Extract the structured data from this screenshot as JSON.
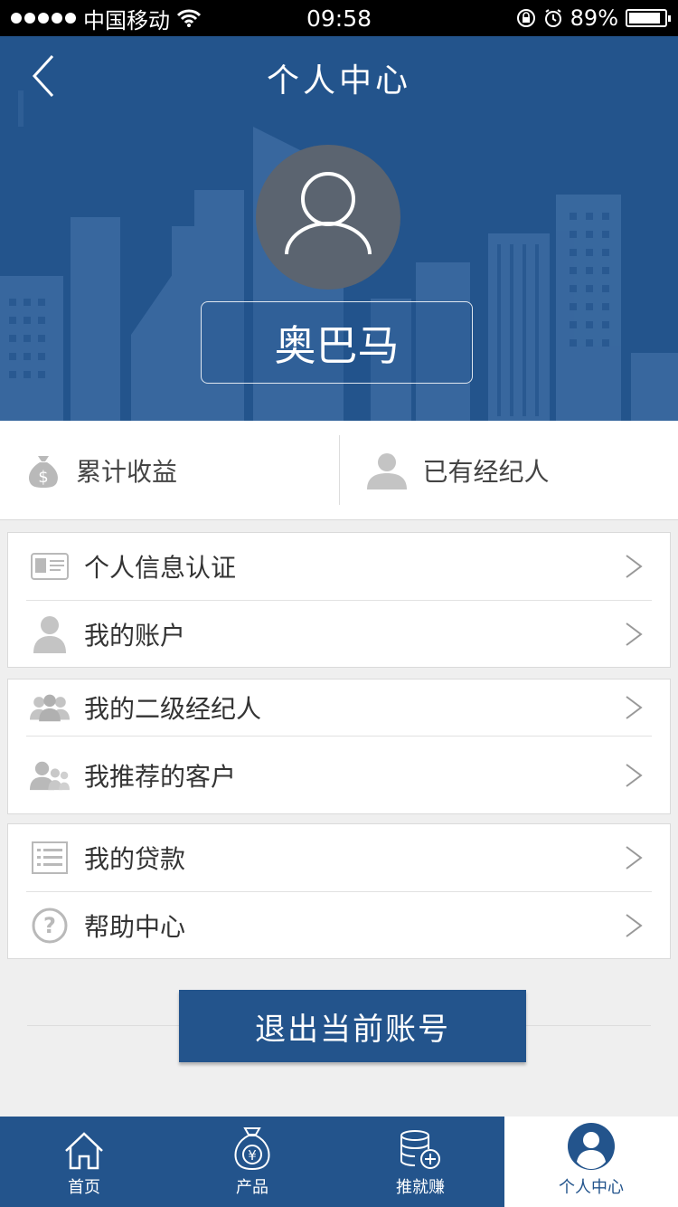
{
  "status_bar": {
    "carrier": "中国移动",
    "time": "09:58",
    "battery": "89%",
    "battery_level": 0.89
  },
  "header": {
    "title": "个人中心",
    "user_name": "奥巴马"
  },
  "stats": [
    {
      "label": "累计收益",
      "icon": "money-bag-icon"
    },
    {
      "label": "已有经纪人",
      "icon": "agent-person-icon"
    }
  ],
  "menu_groups": [
    {
      "items": [
        {
          "label": "个人信息认证",
          "icon": "id-card-icon"
        },
        {
          "label": "我的账户",
          "icon": "person-icon"
        }
      ]
    },
    {
      "items": [
        {
          "label": "我的二级经纪人",
          "icon": "group-icon"
        },
        {
          "label": "我推荐的客户",
          "icon": "customers-icon"
        }
      ]
    },
    {
      "items": [
        {
          "label": "我的贷款",
          "icon": "list-icon"
        },
        {
          "label": "帮助中心",
          "icon": "help-icon"
        }
      ]
    }
  ],
  "logout_label": "退出当前账号",
  "tabs": [
    {
      "label": "首页",
      "icon": "home-icon"
    },
    {
      "label": "产品",
      "icon": "product-bag-icon"
    },
    {
      "label": "推就赚",
      "icon": "database-add-icon"
    },
    {
      "label": "个人中心",
      "icon": "user-center-icon",
      "active": true
    }
  ],
  "colors": {
    "primary": "#23548c",
    "background": "#efefef",
    "icon_gray": "#b9b9b9"
  }
}
